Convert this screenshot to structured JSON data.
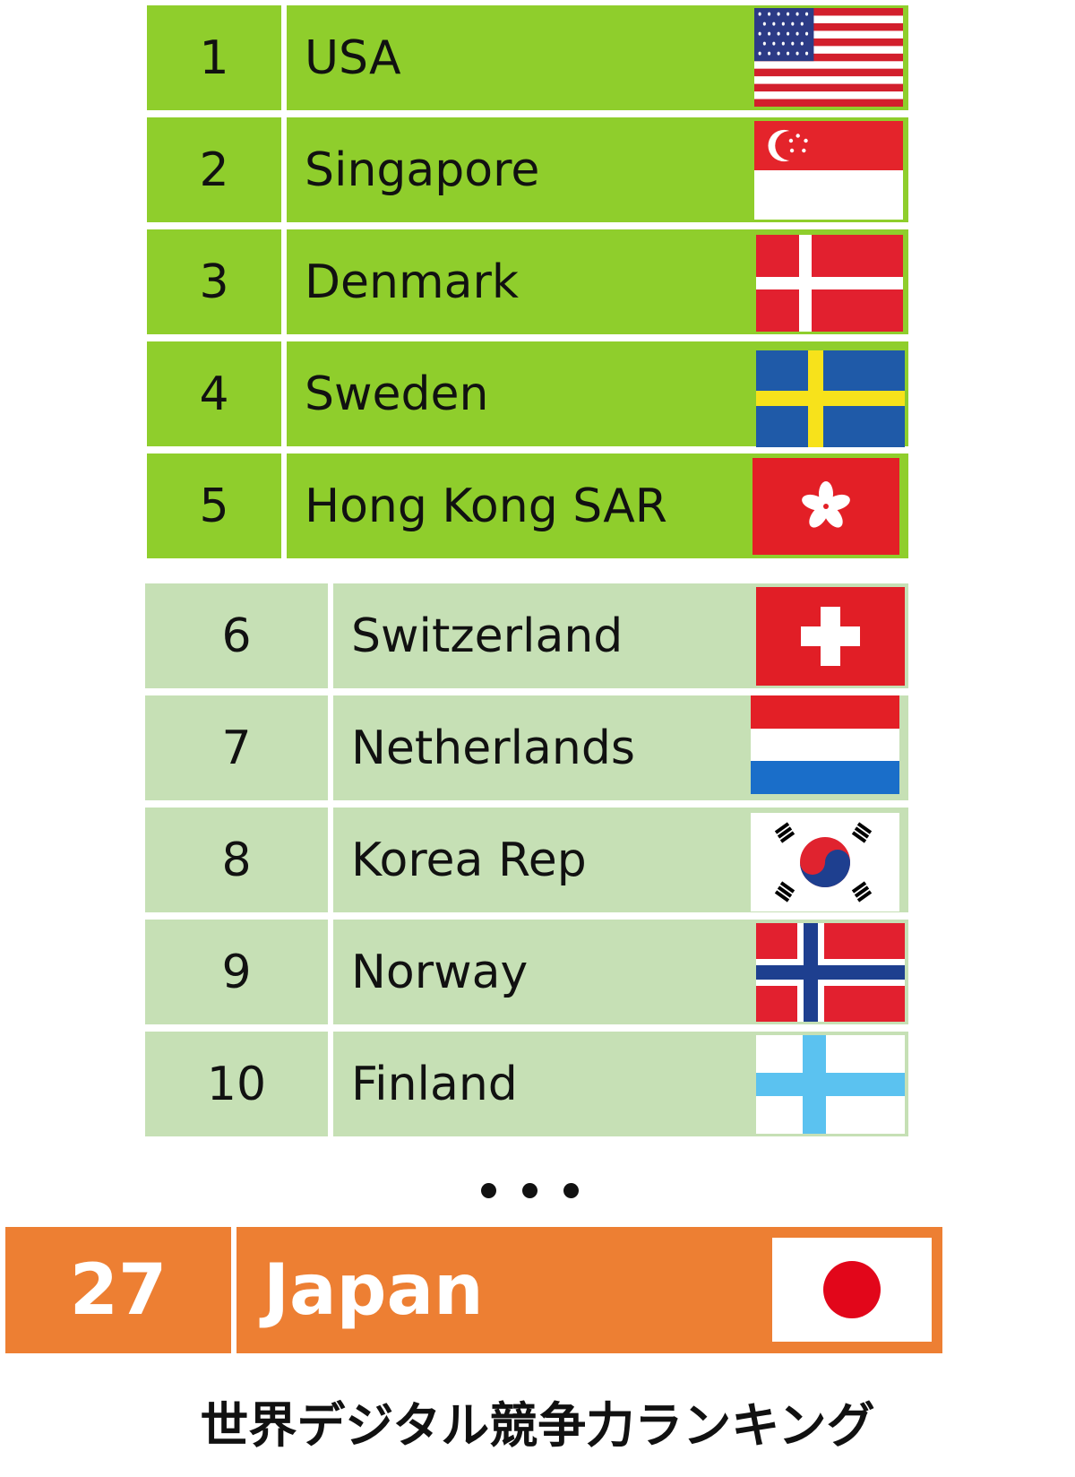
{
  "rankings_top": [
    {
      "rank": "1",
      "country": "USA",
      "flag": "usa-flag-icon"
    },
    {
      "rank": "2",
      "country": "Singapore",
      "flag": "singapore-flag-icon"
    },
    {
      "rank": "3",
      "country": "Denmark",
      "flag": "denmark-flag-icon"
    },
    {
      "rank": "4",
      "country": "Sweden",
      "flag": "sweden-flag-icon"
    },
    {
      "rank": "5",
      "country": "Hong Kong SAR",
      "flag": "hong-kong-flag-icon"
    }
  ],
  "rankings_next": [
    {
      "rank": "6",
      "country": "Switzerland",
      "flag": "switzerland-flag-icon"
    },
    {
      "rank": "7",
      "country": "Netherlands",
      "flag": "netherlands-flag-icon"
    },
    {
      "rank": "8",
      "country": "Korea Rep",
      "flag": "korea-flag-icon"
    },
    {
      "rank": "9",
      "country": "Norway",
      "flag": "norway-flag-icon"
    },
    {
      "rank": "10",
      "country": "Finland",
      "flag": "finland-flag-icon"
    }
  ],
  "highlight": {
    "rank": "27",
    "country": "Japan",
    "flag": "japan-flag-icon"
  },
  "caption": "世界デジタル競争力ランキング",
  "colors": {
    "top_green": "#8fce2c",
    "light_green": "#c6e0b5",
    "japan_orange": "#ed7f33"
  }
}
